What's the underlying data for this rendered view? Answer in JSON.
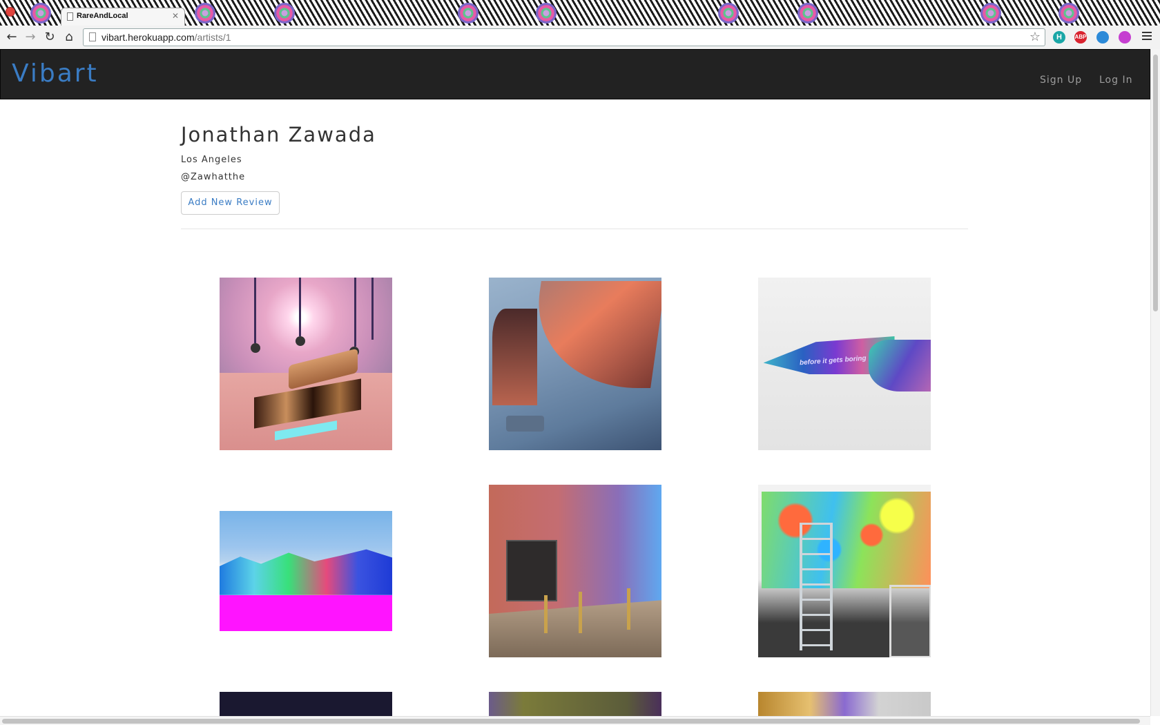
{
  "browser": {
    "tab_title": "RareAndLocal",
    "url_host": "vibart.herokuapp.com",
    "url_path": "/artists/1",
    "extensions": [
      {
        "name": "honey-icon",
        "label": "H",
        "color": "#1aa6a6"
      },
      {
        "name": "adblock-icon",
        "label": "ABP",
        "color": "#d9232f"
      },
      {
        "name": "globe-icon",
        "label": "",
        "color": "#2c8ad8"
      },
      {
        "name": "color-wheel-icon",
        "label": "",
        "color": "#c53fd0"
      }
    ]
  },
  "site": {
    "brand": "Vibart",
    "nav": {
      "signup": "Sign Up",
      "login": "Log In"
    },
    "brand_color": "#3a7cc4"
  },
  "artist": {
    "name": "Jonathan Zawada",
    "location": "Los Angeles",
    "handle": "@Zawhatthe",
    "add_review_label": "Add New Review"
  },
  "gallery": {
    "items": [
      {
        "name": "artwork-1"
      },
      {
        "name": "artwork-2"
      },
      {
        "name": "artwork-3"
      },
      {
        "name": "artwork-4"
      },
      {
        "name": "artwork-5"
      },
      {
        "name": "artwork-6"
      },
      {
        "name": "artwork-7"
      },
      {
        "name": "artwork-8"
      },
      {
        "name": "artwork-9"
      }
    ],
    "knife_text": "before it gets boring"
  }
}
